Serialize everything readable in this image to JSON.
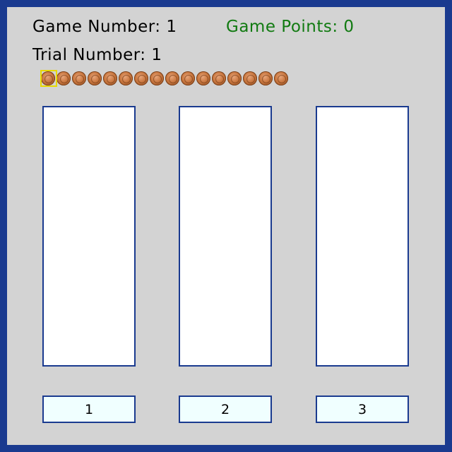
{
  "header": {
    "game_number_label": "Game Number: 1",
    "game_points_label": "Game Points: 0",
    "trial_number_label": "Trial Number: 1"
  },
  "coins": {
    "count": 16,
    "icon": "penny-coin-icon",
    "highlighted_index": 0,
    "highlight_color": "#e8d800"
  },
  "panels": [
    {
      "id": 1,
      "content": ""
    },
    {
      "id": 2,
      "content": ""
    },
    {
      "id": 3,
      "content": ""
    }
  ],
  "buttons": [
    {
      "label": "1"
    },
    {
      "label": "2"
    },
    {
      "label": "3"
    }
  ],
  "colors": {
    "border": "#1a3a8f",
    "background": "#d3d3d3",
    "points_text": "#117a11",
    "button_fill": "#f0ffff"
  }
}
